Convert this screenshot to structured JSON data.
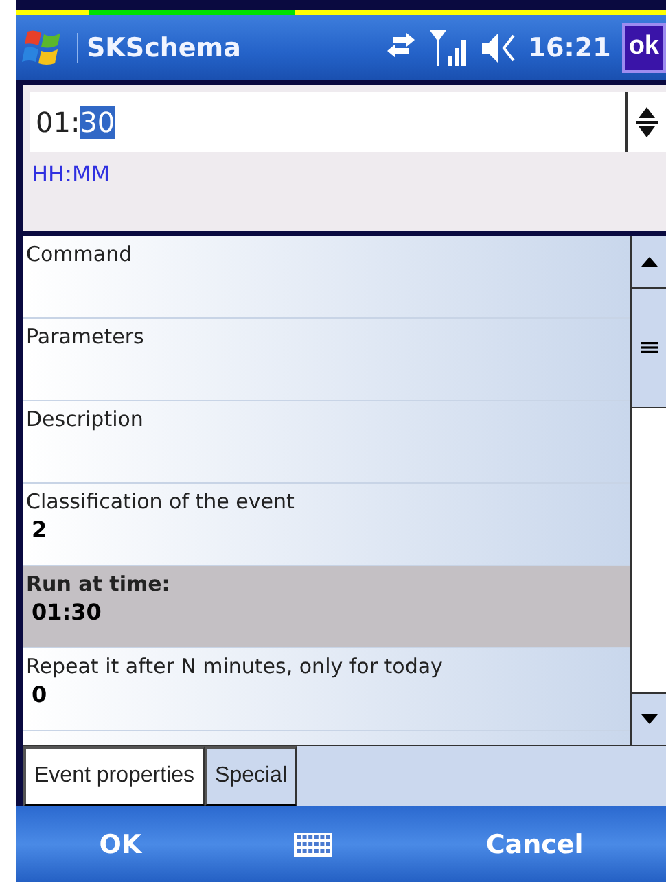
{
  "title_bar": {
    "title": "SKSchema",
    "time": "16:21",
    "ok_button": "ok"
  },
  "time_field": {
    "parts": [
      {
        "text": "01:",
        "selected": false
      },
      {
        "text": "30",
        "selected": true
      }
    ],
    "hint": "HH:MM"
  },
  "properties": [
    {
      "label": "Command",
      "selected": false
    },
    {
      "label": "Parameters",
      "selected": false
    },
    {
      "label": "Description",
      "selected": false
    },
    {
      "label": "Classification of the event",
      "value": "2",
      "selected": false
    },
    {
      "label": "Run at time:",
      "value": "01:30",
      "selected": true
    },
    {
      "label": "Repeat it after N minutes, only for today",
      "value": "0",
      "selected": false
    }
  ],
  "tabs": [
    {
      "label": "Event properties",
      "selected": true
    },
    {
      "label": "Special",
      "selected": false
    }
  ],
  "menu_bar": {
    "left": "OK",
    "right": "Cancel"
  }
}
